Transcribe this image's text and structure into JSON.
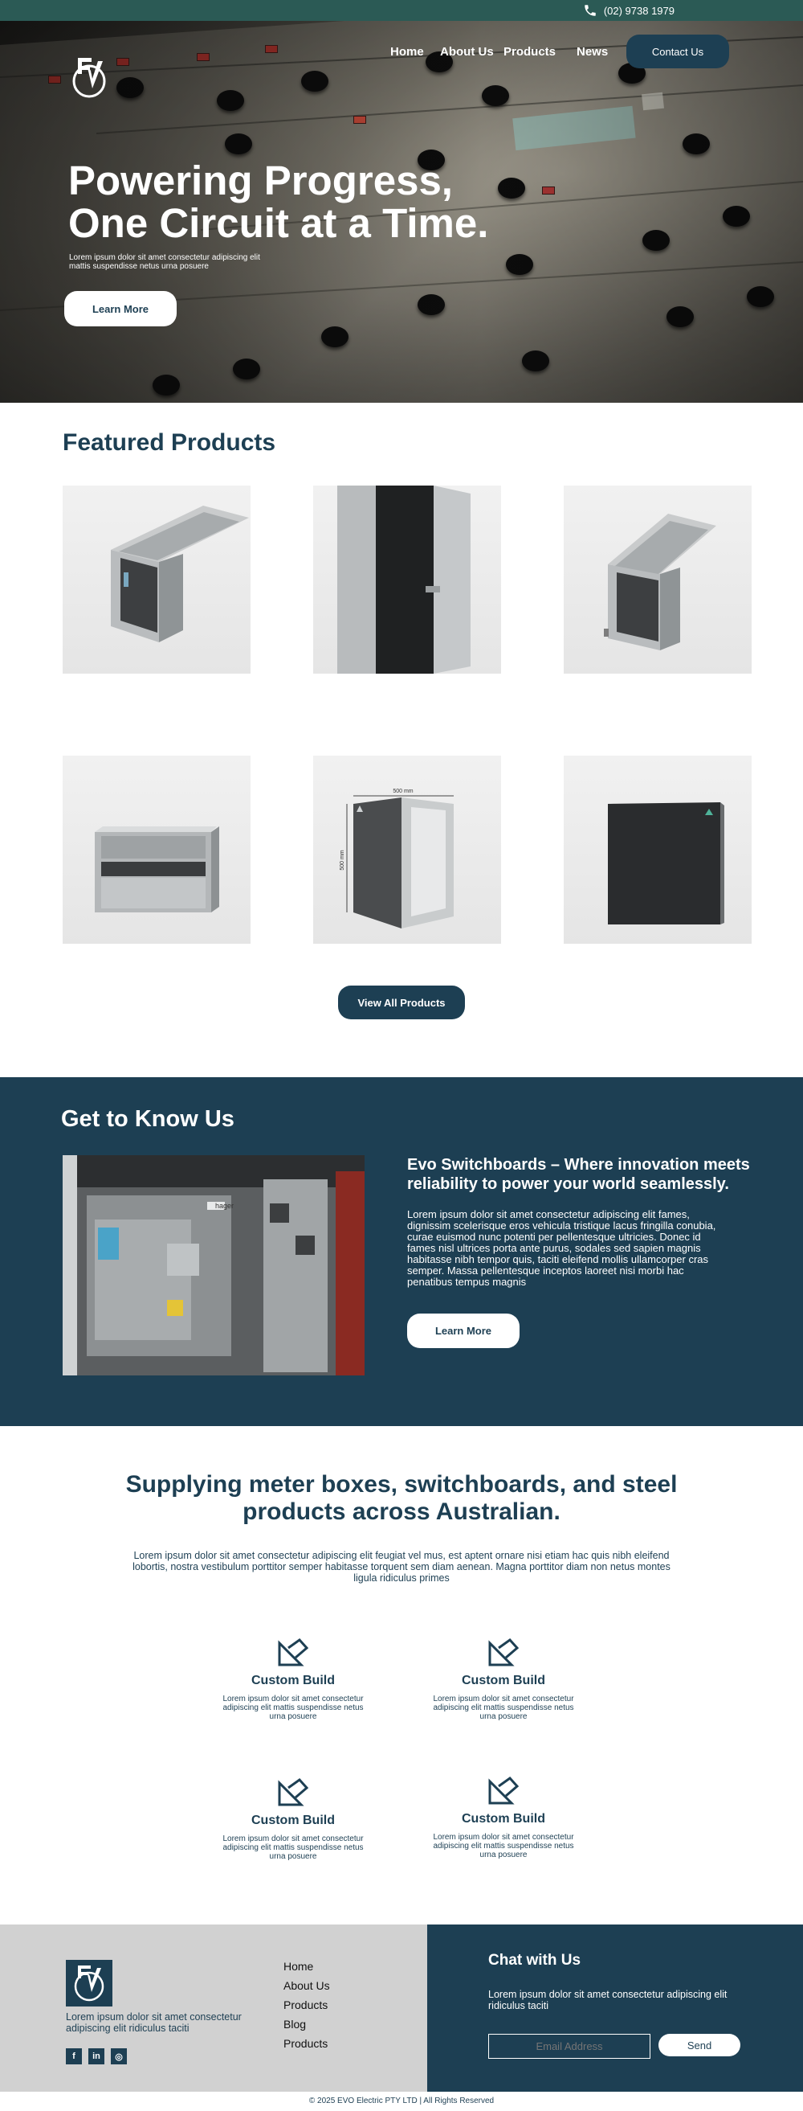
{
  "topbar": {
    "phone": "(02) 9738 1979",
    "phone_icon": "phone-icon"
  },
  "nav": {
    "home": "Home",
    "about": "About Us",
    "products": "Products",
    "news": "News",
    "contact": "Contact Us"
  },
  "hero": {
    "title_line1": "Powering Progress,",
    "title_line2": "One Circuit at a Time.",
    "subtitle": "Lorem ipsum dolor sit amet consectetur adipiscing elit mattis suspendisse netus urna posuere",
    "button": "Learn More"
  },
  "featured": {
    "title": "Featured Products",
    "products": [
      "open-lid-enclosure",
      "open-door-cabinet",
      "open-lid-enclosure-small",
      "meter-box-enclosure",
      "dimensioned-cabinet",
      "closed-panel"
    ],
    "dimension_top": "500 mm",
    "dimension_side": "500 mm",
    "button": "View All Products"
  },
  "about": {
    "title": "Get to Know Us",
    "heading": "Evo Switchboards – Where innovation meets reliability to power your world seamlessly.",
    "body": "Lorem ipsum dolor sit amet consectetur adipiscing elit fames, dignissim scelerisque eros vehicula tristique lacus fringilla conubia, curae euismod nunc potenti per pellentesque ultricies. Donec id fames nisl ultrices porta ante purus, sodales sed sapien magnis habitasse nibh tempor quis, taciti eleifend mollis ullamcorper cras semper. Massa pellentesque inceptos laoreet nisi morbi hac penatibus tempus magnis",
    "button": "Learn More",
    "image_brand": "hager"
  },
  "supply": {
    "title": "Supplying meter boxes, switchboards, and steel products across Australian.",
    "body": "Lorem ipsum dolor sit amet consectetur adipiscing elit feugiat vel mus, est aptent ornare nisi etiam hac quis nibh eleifend lobortis, nostra vestibulum porttitor semper habitasse torquent sem diam aenean. Magna porttitor diam non netus montes ligula ridiculus primes",
    "features": [
      {
        "title": "Custom Build",
        "body": "Lorem ipsum dolor sit amet consectetur adipiscing elit mattis suspendisse netus urna posuere",
        "icon": "ruler-pencil-icon"
      },
      {
        "title": "Custom Build",
        "body": "Lorem ipsum dolor sit amet consectetur adipiscing elit mattis suspendisse netus urna posuere",
        "icon": "ruler-pencil-icon"
      },
      {
        "title": "Custom Build",
        "body": "Lorem ipsum dolor sit amet consectetur adipiscing elit mattis suspendisse netus urna posuere",
        "icon": "ruler-pencil-icon"
      },
      {
        "title": "Custom Build",
        "body": "Lorem ipsum dolor sit amet consectetur adipiscing elit mattis suspendisse netus urna posuere",
        "icon": "ruler-pencil-icon"
      }
    ]
  },
  "footer": {
    "description": "Lorem ipsum dolor sit amet consectetur adipiscing elit ridiculus taciti",
    "social": [
      "facebook-icon",
      "linkedin-icon",
      "instagram-icon"
    ],
    "social_glyphs": [
      "f",
      "in",
      "◎"
    ],
    "links": [
      "Home",
      "About Us",
      "Products",
      "Blog",
      "Products"
    ],
    "chat_title": "Chat with Us",
    "chat_body": "Lorem ipsum dolor sit amet consectetur adipiscing elit ridiculus taciti",
    "email_placeholder": "Email Address",
    "send": "Send",
    "copyright": "© 2025 EVO Electric PTY LTD | All Rights Reserved"
  },
  "colors": {
    "navy": "#1d3f53",
    "topbar": "#2b5a55",
    "footer_grey": "#d1d1d1"
  }
}
